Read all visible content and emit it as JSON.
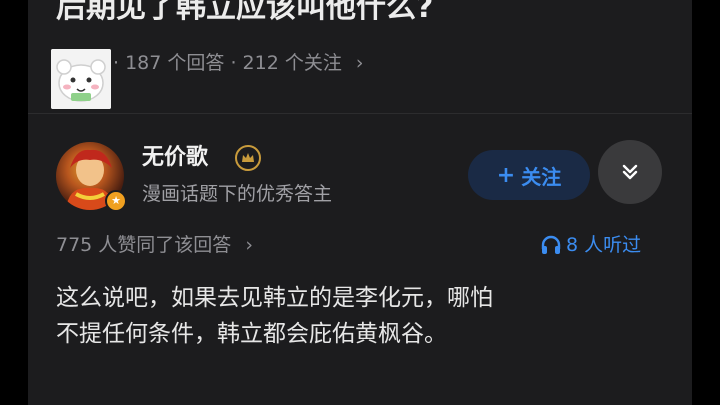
{
  "question": {
    "title": "后期见了韩立应该叫他什么?",
    "answers_count": "187 个回答",
    "followers_count": "212 个关注",
    "meta_separator": "·",
    "meta_chevron": "›"
  },
  "author": {
    "name": "无价歌",
    "description": "漫画话题下的优秀答主",
    "badge_icon": "star-icon"
  },
  "follow_button": {
    "plus": "+",
    "label": "关注"
  },
  "answer": {
    "upvotes": "775 人赞同了该回答",
    "upvotes_chevron": "›",
    "listeners": "8 人听过",
    "text_line_1": "这么说吧，如果去见韩立的是李化元，哪怕",
    "text_line_2": "不提任何条件，韩立都会庇佑黄枫谷。"
  },
  "colors": {
    "background": "#1c1c1e",
    "accent": "#3b8cf0",
    "muted": "#8e8e93",
    "text": "#e6e6e6"
  }
}
